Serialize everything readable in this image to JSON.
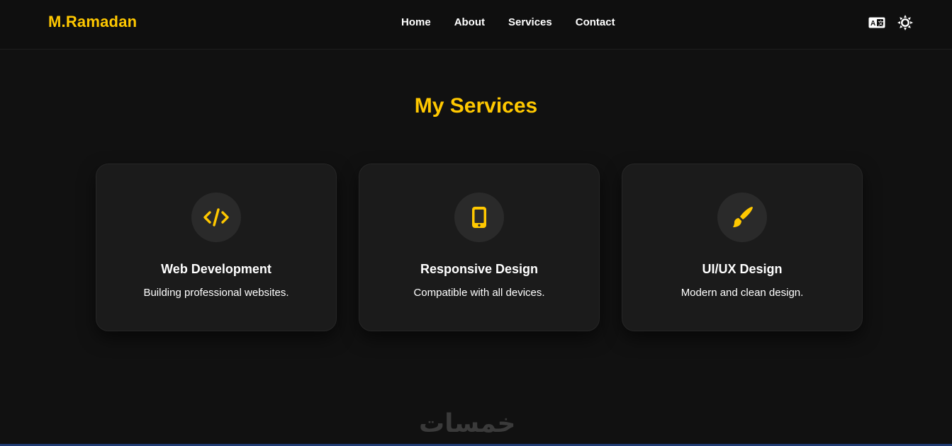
{
  "header": {
    "brand": "M.Ramadan",
    "nav": [
      {
        "label": "Home"
      },
      {
        "label": "About"
      },
      {
        "label": "Services"
      },
      {
        "label": "Contact"
      }
    ],
    "tools": {
      "language_icon": "translate-icon",
      "theme_icon": "sun-icon"
    }
  },
  "services": {
    "title": "My Services",
    "cards": [
      {
        "icon": "code-icon",
        "title": "Web Development",
        "desc": "Building professional websites."
      },
      {
        "icon": "mobile-icon",
        "title": "Responsive Design",
        "desc": "Compatible with all devices."
      },
      {
        "icon": "paintbrush-icon",
        "title": "UI/UX Design",
        "desc": "Modern and clean design."
      }
    ]
  },
  "footer": {
    "watermark": "خمسات"
  },
  "colors": {
    "accent": "#ffc800",
    "background": "#111111",
    "card": "#1b1b1b"
  }
}
